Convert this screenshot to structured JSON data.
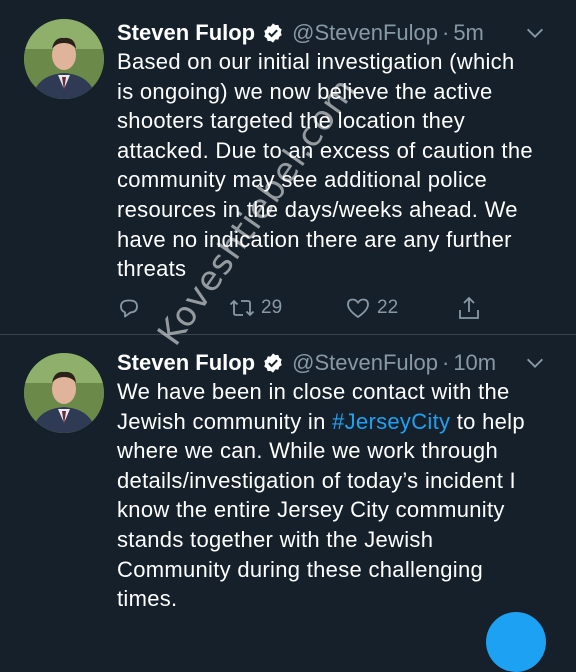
{
  "tweets": [
    {
      "display_name": "Steven Fulop",
      "handle": "@StevenFulop",
      "dot": "·",
      "time": "5m",
      "text": "Based on our initial investigation (which\nis ongoing) we now believe the active\nshooters targeted the location they\nattacked. Due to an excess of caution the\ncommunity may see additional police\nresources in the days/weeks ahead. We\nhave no indication there are any further\nthreats",
      "retweet_count": "29",
      "like_count": "22"
    },
    {
      "display_name": "Steven Fulop",
      "handle": "@StevenFulop",
      "dot": "·",
      "time": "10m",
      "text_before": "We have been in close contact with the\nJewish community in ",
      "hashtag": "#JerseyCity",
      "text_after": " to help\nwhere we can. While we work through\ndetails/investigation of today’s incident I\nknow the entire Jersey City community\nstands together with the Jewish\nCommunity during these challenging\ntimes."
    }
  ],
  "watermark": "Koveshtiebel.com",
  "colors": {
    "background": "#15202b",
    "secondary_text": "#8899a6",
    "accent": "#1da1f2",
    "divider": "#38444d"
  },
  "icons": [
    "verified-badge-icon",
    "chevron-down-icon",
    "reply-icon",
    "retweet-icon",
    "like-icon",
    "share-icon"
  ]
}
